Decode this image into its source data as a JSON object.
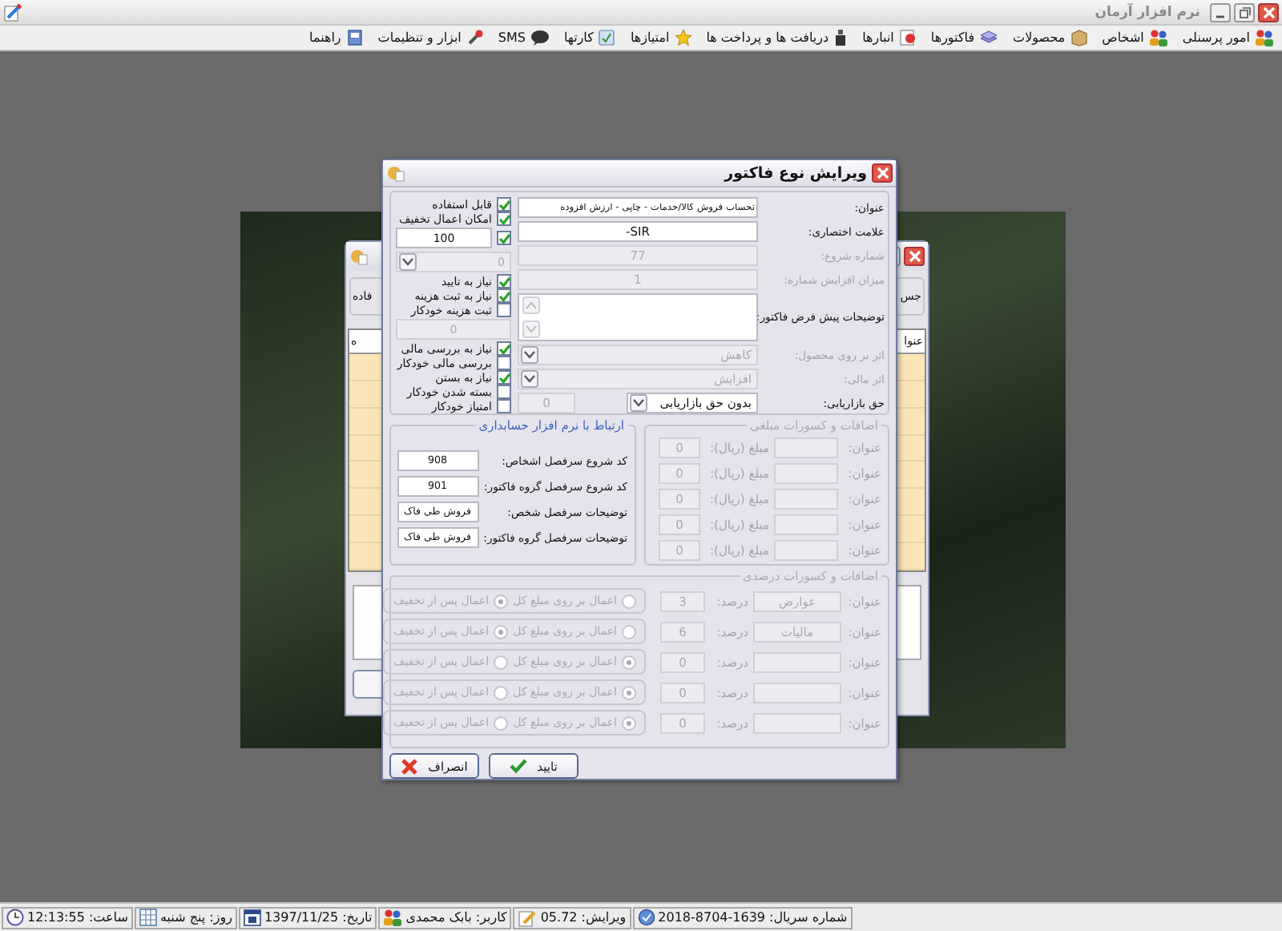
{
  "app": {
    "title": "نرم افزار آرمان",
    "menu": [
      {
        "label": "امور پرسنلی"
      },
      {
        "label": "اشخاص"
      },
      {
        "label": "محصولات"
      },
      {
        "label": "فاکتورها"
      },
      {
        "label": "انبارها"
      },
      {
        "label": "دریافت ها و پرداخت ها"
      },
      {
        "label": "امتیازها"
      },
      {
        "label": "کارتها"
      },
      {
        "label": "SMS"
      },
      {
        "label": "ابزار و تنظیمات"
      },
      {
        "label": "راهنما"
      }
    ]
  },
  "background_window": {
    "toolbar_texts": [
      "جس",
      "فاده"
    ],
    "columns": [
      "عنوا",
      "ه"
    ]
  },
  "dialog": {
    "title": "ویرایش نوع فاکتور",
    "fields": [
      {
        "kind": "text",
        "label": "عنوان:",
        "value": "تحساب فروش کالا/خدمات - چاپی - ارزش افزوده",
        "disabled": false
      },
      {
        "kind": "text",
        "label": "علامت اختصاری:",
        "value": "SIR-",
        "disabled": false
      },
      {
        "kind": "text",
        "label": "شماره شروع:",
        "value": "77",
        "disabled": true
      },
      {
        "kind": "text",
        "label": "میزان افزایش شماره:",
        "value": "1",
        "disabled": true
      },
      {
        "kind": "textarea",
        "label": "توضیحات پیش فرض فاکتور:",
        "disabled": false
      },
      {
        "kind": "select",
        "label": "اثر بر روی محصول:",
        "value": "کاهش",
        "disabled": true
      },
      {
        "kind": "select",
        "label": "اثر مالی:",
        "value": "افزایش",
        "disabled": true
      },
      {
        "kind": "select-field",
        "label": "حق بازاریابی:",
        "value": "بدون حق بازاریابی",
        "disabled": false,
        "extra": "0",
        "extra_disabled": true
      }
    ],
    "options": [
      {
        "kind": "check",
        "label": "قابل استفاده",
        "checked": true
      },
      {
        "kind": "check",
        "label": "امکان اعمال تخفیف",
        "checked": true
      },
      {
        "kind": "check-field",
        "checked": true,
        "value": "100"
      },
      {
        "kind": "select",
        "value": "0",
        "disabled": true
      },
      {
        "kind": "check",
        "label": "نیاز به تایید",
        "checked": true
      },
      {
        "kind": "check",
        "label": "نیاز به ثبت هزینه",
        "checked": true
      },
      {
        "kind": "check",
        "label": "ثبت هزینه خودکار",
        "checked": false
      },
      {
        "kind": "field",
        "value": "0",
        "disabled": true
      },
      {
        "kind": "check",
        "label": "نیاز به بررسی مالی",
        "checked": true
      },
      {
        "kind": "check",
        "label": "بررسی مالی خودکار",
        "checked": false
      },
      {
        "kind": "check",
        "label": "نیاز به بستن",
        "checked": true
      },
      {
        "kind": "check",
        "label": "بسته شدن خودکار",
        "checked": false
      },
      {
        "kind": "check",
        "label": "امتیاز خودکار",
        "checked": false
      }
    ],
    "fixed_charges": {
      "title": "اضافات و کسورات مبلغی",
      "disabled": true,
      "rows": [
        {
          "title_label": "عنوان:",
          "amount_label": "مبلغ (ریال):",
          "amount": "0"
        },
        {
          "title_label": "عنوان:",
          "amount_label": "مبلغ (ریال):",
          "amount": "0"
        },
        {
          "title_label": "عنوان:",
          "amount_label": "مبلغ (ریال):",
          "amount": "0"
        },
        {
          "title_label": "عنوان:",
          "amount_label": "مبلغ (ریال):",
          "amount": "0"
        },
        {
          "title_label": "عنوان:",
          "amount_label": "مبلغ (ریال):",
          "amount": "0"
        }
      ]
    },
    "accounting": {
      "title": "ارتباط با نرم افزار حسابداری",
      "rows": [
        {
          "label": "کد شروع سرفصل اشخاص:",
          "value": "908"
        },
        {
          "label": "کد شروع سرفصل گروه فاکتور:",
          "value": "901"
        },
        {
          "label": "توضیحات سرفصل شخص:",
          "value": "فروش طی فاک"
        },
        {
          "label": "توضیحات سرفصل گروه فاکتور:",
          "value": "فروش طی فاک"
        }
      ]
    },
    "percent_charges": {
      "title": "اضافات و کسورات درصدی",
      "disabled": true,
      "rows": [
        {
          "title_label": "عنوان:",
          "title_value": "عوارض",
          "percent_label": "درصد:",
          "percent": "3",
          "modes": [
            {
              "label": "اعمال بر روی مبلغ کل",
              "selected": false
            },
            {
              "label": "اعمال پس از تخفیف",
              "selected": true
            }
          ]
        },
        {
          "title_label": "عنوان:",
          "title_value": "مالیات",
          "percent_label": "درصد:",
          "percent": "6",
          "modes": [
            {
              "label": "اعمال بر روی مبلغ کل",
              "selected": false
            },
            {
              "label": "اعمال پس از تخفیف",
              "selected": true
            }
          ]
        },
        {
          "title_label": "عنوان:",
          "percent_label": "درصد:",
          "percent": "0",
          "modes": [
            {
              "label": "اعمال بر روی مبلغ کل",
              "selected": true
            },
            {
              "label": "اعمال پس از تخفیف",
              "selected": false
            }
          ]
        },
        {
          "title_label": "عنوان:",
          "percent_label": "درصد:",
          "percent": "0",
          "modes": [
            {
              "label": "اعمال بر روی مبلغ کل",
              "selected": true
            },
            {
              "label": "اعمال پس از تخفیف",
              "selected": false
            }
          ]
        },
        {
          "title_label": "عنوان:",
          "percent_label": "درصد:",
          "percent": "0",
          "modes": [
            {
              "label": "اعمال بر روی مبلغ کل",
              "selected": true
            },
            {
              "label": "اعمال پس از تخفیف",
              "selected": false
            }
          ]
        }
      ]
    },
    "buttons": [
      {
        "kind": "confirm",
        "label": "تایید"
      },
      {
        "kind": "cancel",
        "label": "انصراف"
      }
    ]
  },
  "status_bar": [
    {
      "kind": "serial",
      "text": "شماره سریال: 1639-8704-2018"
    },
    {
      "kind": "version",
      "text": "ویرایش: 05.72"
    },
    {
      "kind": "user",
      "text": "کاربر: بابک محمدی"
    },
    {
      "kind": "date",
      "text": "تاریخ: 1397/11/25"
    },
    {
      "kind": "day",
      "text": "روز: پنج شنبه"
    },
    {
      "kind": "time",
      "text": "ساعت: 12:13:55"
    }
  ]
}
